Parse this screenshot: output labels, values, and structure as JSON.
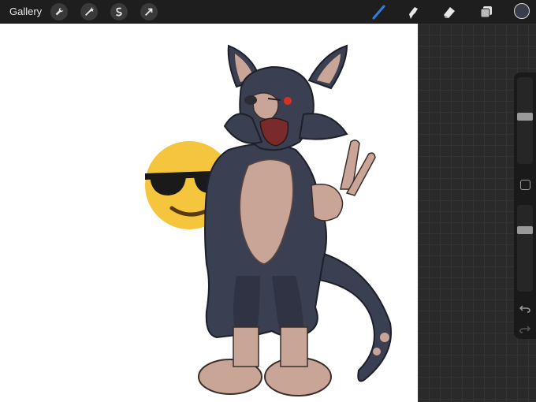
{
  "toolbar": {
    "gallery_label": "Gallery",
    "left_tools": [
      {
        "name": "actions",
        "icon": "wrench-icon"
      },
      {
        "name": "adjustments",
        "icon": "magic-wand-icon"
      },
      {
        "name": "selection",
        "icon": "selection-s-icon"
      },
      {
        "name": "transform",
        "icon": "arrow-cursor-icon"
      }
    ],
    "right_tools": [
      {
        "name": "brush",
        "icon": "brush-icon",
        "active": true
      },
      {
        "name": "smudge",
        "icon": "smudge-icon"
      },
      {
        "name": "eraser",
        "icon": "eraser-icon"
      },
      {
        "name": "layers",
        "icon": "layers-icon"
      }
    ],
    "current_color": "#3a3c4a",
    "active_color": "#2f7ddf"
  },
  "sidebar": {
    "brush_size_level": 0.45,
    "opacity_level": 0.27,
    "modify_button": "square-icon",
    "undo": "undo-icon",
    "redo": "redo-icon"
  },
  "canvas": {
    "background": "#ffffff",
    "artwork": "character-illustration",
    "sticker": "sunglasses-emoji"
  }
}
